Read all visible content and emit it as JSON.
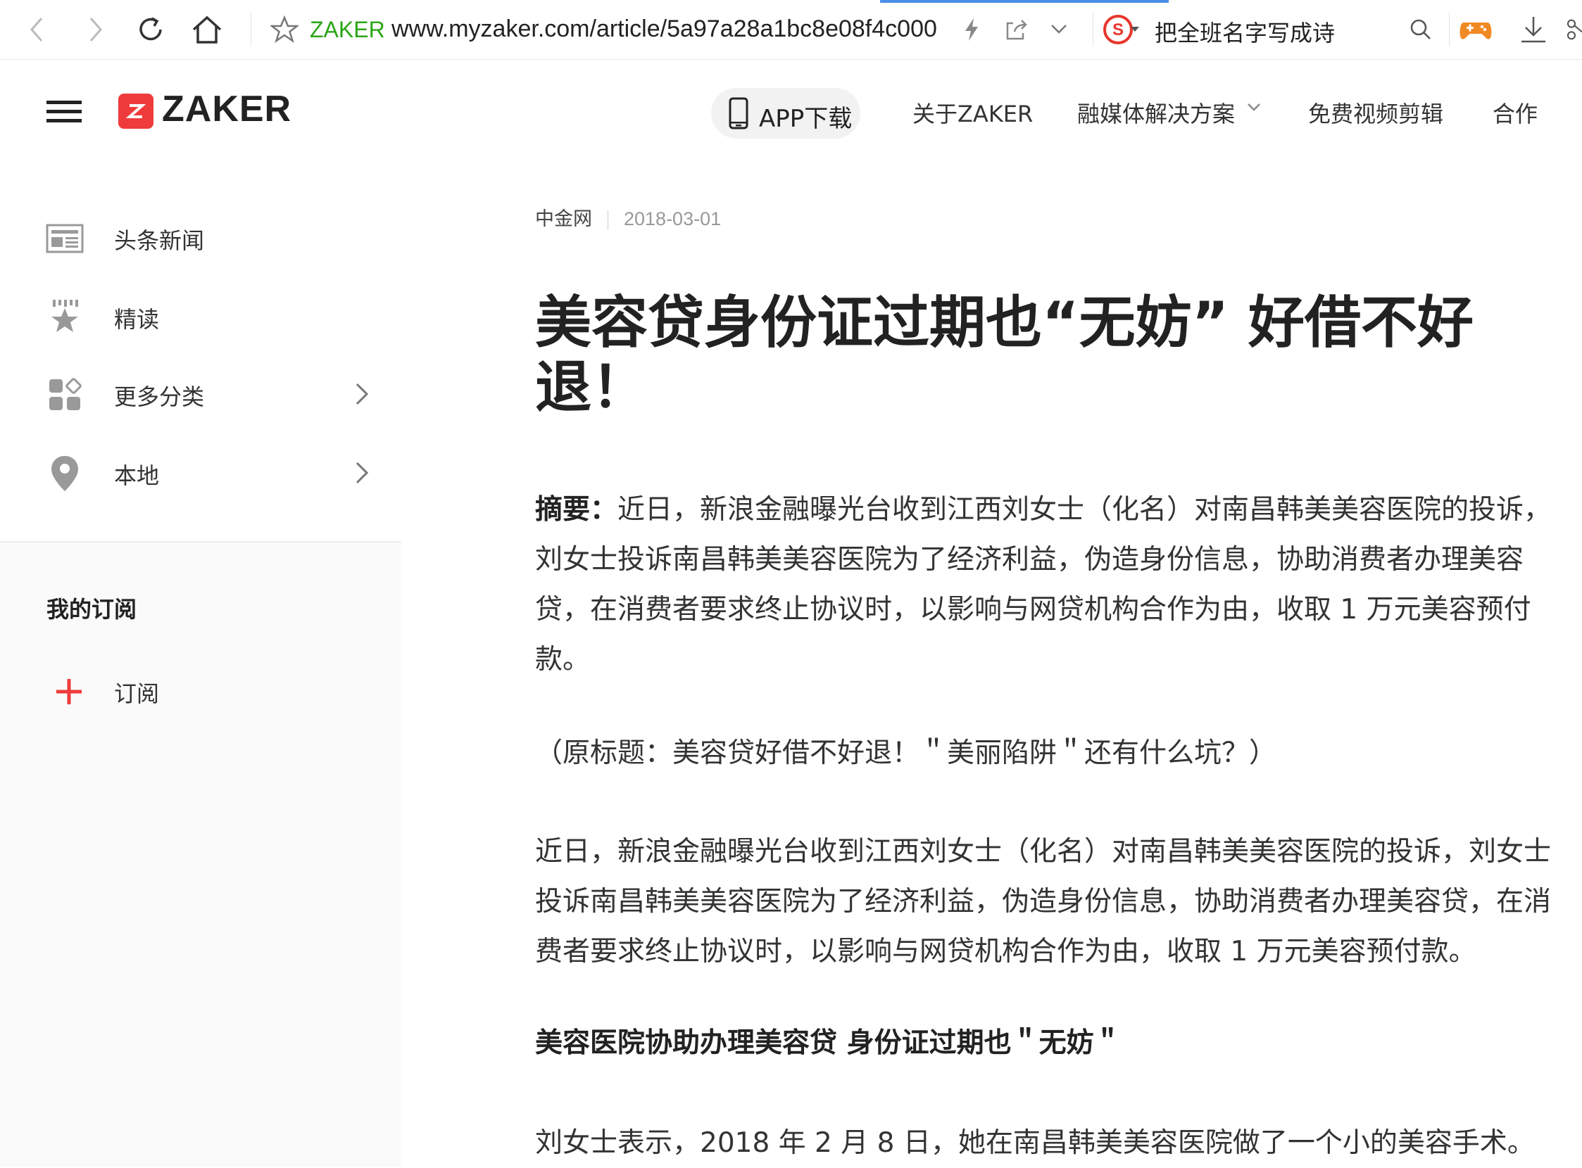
{
  "browser": {
    "site_label": "ZAKER",
    "url": "www.myzaker.com/article/5a97a28a1bc8e08f4c000",
    "search_text": "把全班名字写成诗"
  },
  "header": {
    "logo_text": "ZAKER",
    "app_button": "APP下载",
    "nav": [
      "关于ZAKER",
      "融媒体解决方案",
      "免费视频剪辑",
      "合作"
    ]
  },
  "sidebar": {
    "items": [
      {
        "label": "头条新闻"
      },
      {
        "label": "精读"
      },
      {
        "label": "更多分类"
      },
      {
        "label": "本地"
      }
    ],
    "subscription_title": "我的订阅",
    "subscribe_label": "订阅"
  },
  "article": {
    "source": "中金网",
    "date": "2018-03-01",
    "title": "美容贷身份证过期也“无妨” 好借不好退！",
    "summary_label": "摘要：",
    "summary": "近日，新浪金融曝光台收到江西刘女士（化名）对南昌韩美美容医院的投诉，刘女士投诉南昌韩美美容医院为了经济利益，伪造身份信息，协助消费者办理美容贷，在消费者要求终止协议时，以影响与网贷机构合作为由，收取 1 万元美容预付款。",
    "original_title": "（原标题：美容贷好借不好退！＂美丽陷阱＂还有什么坑？）",
    "paragraph1": "近日，新浪金融曝光台收到江西刘女士（化名）对南昌韩美美容医院的投诉，刘女士投诉南昌韩美美容医院为了经济利益，伪造身份信息，协助消费者办理美容贷，在消费者要求终止协议时，以影响与网贷机构合作为由，收取 1 万元美容预付款。",
    "subheading": "美容医院协助办理美容贷 身份证过期也＂无妨＂",
    "paragraph2": "刘女士表示，2018 年 2 月 8 日，她在南昌韩美美容医院做了一个小的美容手术。"
  },
  "colors": {
    "brand_red": "#ef3b3b",
    "site_green": "#2aa515",
    "sogou_red": "#e8362d"
  }
}
